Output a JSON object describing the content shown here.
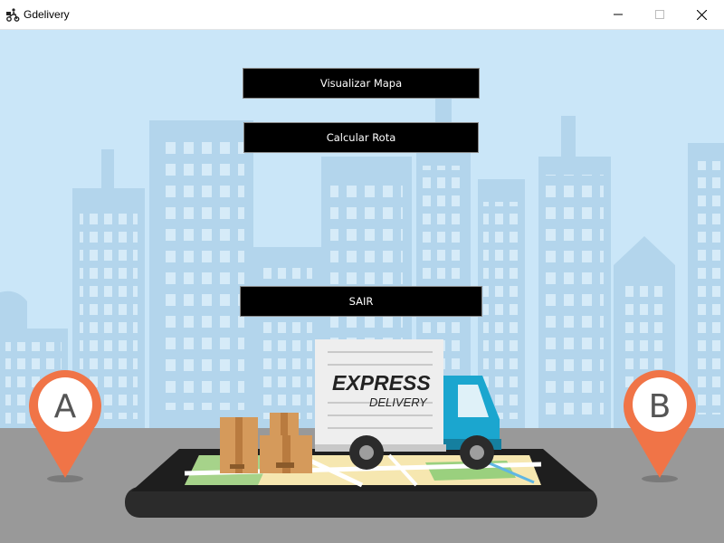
{
  "window": {
    "title": "Gdelivery",
    "icon": "delivery-scooter-icon",
    "controls": {
      "minimize": "minimize-icon",
      "maximize": "maximize-icon",
      "close": "close-icon"
    }
  },
  "menu": {
    "view_map_label": "Visualizar Mapa",
    "calc_route_label": "Calcular Rota",
    "exit_label": "SAIR"
  },
  "illustration": {
    "truck_text_line1": "EXPRESS",
    "truck_text_line2": "DELIVERY",
    "pin_a_label": "A",
    "pin_b_label": "B"
  },
  "colors": {
    "sky": "#cae6f8",
    "buildings": "#b3d5ec",
    "road": "#999999",
    "pin": "#f07447",
    "truck_cab": "#1ba6cf",
    "button_bg": "#000000"
  }
}
